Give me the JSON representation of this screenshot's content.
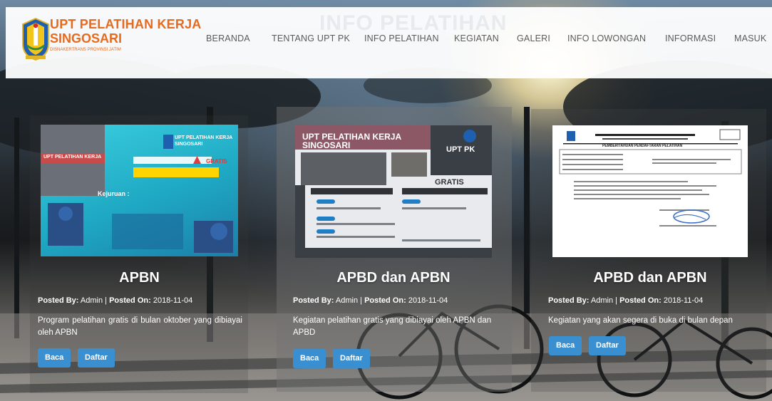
{
  "header": {
    "ghost_title": "INFO PELATIHAN",
    "brand": {
      "line1": "UPT PELATIHAN KERJA",
      "line2": "SINGOSARI",
      "subtitle": "DISNAKERTRANS PROVINSI JATIM"
    },
    "nav": [
      "BERANDA",
      "TENTANG UPT PK",
      "INFO PELATIHAN",
      "KEGIATAN",
      "GALERI",
      "INFO LOWONGAN",
      "INFORMASI",
      "MASUK"
    ]
  },
  "cards": [
    {
      "title": "APBN",
      "posted_by_label": "Posted By:",
      "author": "Admin",
      "posted_on_label": "Posted On:",
      "date": "2018-11-04",
      "description": "Program pelatihan gratis di bulan oktober yang dibiayai oleh APBN",
      "read_label": "Baca",
      "register_label": "Daftar",
      "thumb": {
        "heading": "UPT PELATIHAN KERJA SINGOSARI",
        "badge": "GRATIS",
        "banner": "UPT PELATIHAN KERJA",
        "list_title": "Kejuruan :"
      }
    },
    {
      "title": "APBD dan APBN",
      "posted_by_label": "Posted By:",
      "author": "Admin",
      "posted_on_label": "Posted On:",
      "date": "2018-11-04",
      "description": "Kegiatan pelatihan gratis yang dibiayai oleh APBN dan APBD",
      "read_label": "Baca",
      "register_label": "Daftar",
      "thumb": {
        "heading": "UPT PELATIHAN KERJA SINGOSARI",
        "badge": "GRATIS",
        "org": "UPT PK"
      }
    },
    {
      "title": "APBD dan APBN",
      "posted_by_label": "Posted By:",
      "author": "Admin",
      "posted_on_label": "Posted On:",
      "date": "2018-11-04",
      "description": "Kegiatan yang akan segera di buka di bulan depan",
      "read_label": "Baca",
      "register_label": "Daftar",
      "thumb": {
        "heading": "PEMBERITAHUAN PENDAFTARAN PELATIHAN"
      }
    }
  ],
  "colors": {
    "brand_orange": "#e86a1c",
    "button_blue": "#3a8fd0",
    "nav_text": "#5b5b5b",
    "card_cyan": "#34c3d6"
  }
}
